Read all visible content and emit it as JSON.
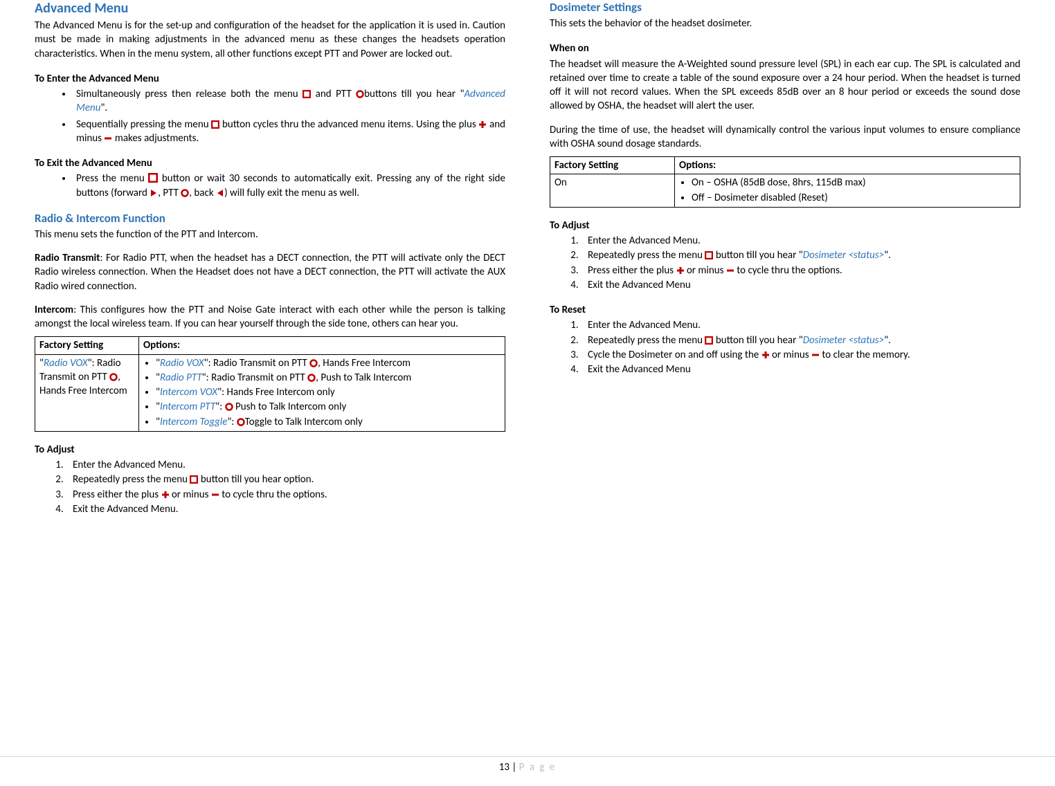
{
  "left": {
    "h_adv": "Advanced Menu",
    "p_adv": "The Advanced Menu is for the set-up and configuration of the headset for the application it is used in. Caution must be made in making adjustments in the advanced menu as these changes the headsets operation characteristics. When in the menu system, all other functions except PTT and Power are locked out.",
    "h_enter": "To Enter the Advanced Menu",
    "enter_b1a": "Simultaneously press then release both the menu ",
    "enter_b1b": " and PTT ",
    "enter_b1c": "buttons till you hear \"",
    "enter_b1_link": "Advanced Menu",
    "enter_b1d": "\".",
    "enter_b2a": "Sequentially pressing the menu ",
    "enter_b2b": " button cycles thru the advanced menu items. Using the plus ",
    "enter_b2c": " and minus ",
    "enter_b2d": " makes adjustments.",
    "h_exit": "To Exit the Advanced Menu",
    "exit_b1a": "Press the menu ",
    "exit_b1b": " button or wait 30 seconds to automatically exit. Pressing any of the right side buttons (forward ",
    "exit_b1c": ", PTT ",
    "exit_b1d": ", back ",
    "exit_b1e": ") will fully exit the menu as well.",
    "h_radio": "Radio & Intercom Function",
    "p_radio_intro": "This menu sets the function of the PTT and Intercom.",
    "p_radio_tx_label": "Radio Transmit",
    "p_radio_tx": ": For Radio PTT, when the headset has a DECT connection, the PTT will activate only the DECT Radio wireless connection. When the Headset does not have a DECT connection, the PTT will activate the AUX Radio wired connection.",
    "p_intercom_label": "Intercom",
    "p_intercom": ": This configures how the PTT and Noise Gate interact with each other while the person is talking amongst the local wireless team. If you can hear yourself through the side tone, others can hear you.",
    "tbl1_h1": "Factory Setting",
    "tbl1_h2": "Options:",
    "tbl1_fs1": "\"",
    "tbl1_fs_link": "Radio VOX",
    "tbl1_fs2": "\": Radio Transmit on PTT ",
    "tbl1_fs3": ", Hands Free Intercom",
    "tbl1_o1a": "\"",
    "tbl1_o1_link": "Radio VOX",
    "tbl1_o1b": "\": Radio Transmit on PTT ",
    "tbl1_o1c": ", Hands Free Intercom",
    "tbl1_o2a": "\"",
    "tbl1_o2_link": "Radio PTT",
    "tbl1_o2b": "\": Radio Transmit on PTT ",
    "tbl1_o2c": ", Push to Talk Intercom",
    "tbl1_o3a": "\"",
    "tbl1_o3_link": "Intercom VOX",
    "tbl1_o3b": "\": Hands Free Intercom only",
    "tbl1_o4a": "\"",
    "tbl1_o4_link": "Intercom PTT",
    "tbl1_o4b": "\": ",
    "tbl1_o4c": " Push to Talk Intercom only",
    "tbl1_o5a": "\"",
    "tbl1_o5_link": "Intercom Toggle",
    "tbl1_o5b": "\": ",
    "tbl1_o5c": "Toggle to Talk Intercom only",
    "h_adjust1": "To Adjust",
    "adj1_1": "Enter the Advanced Menu.",
    "adj1_2a": "Repeatedly press the menu ",
    "adj1_2b": " button till you hear option.",
    "adj1_3a": "Press either the plus ",
    "adj1_3b": " or minus ",
    "adj1_3c": " to cycle thru the options.",
    "adj1_4": "Exit the Advanced Menu."
  },
  "right": {
    "h_dos": "Dosimeter Settings",
    "p_dos_intro": "This sets the behavior of the headset dosimeter.",
    "h_when": "When on",
    "p_when": "The headset will measure the A-Weighted sound pressure level (SPL) in each ear cup. The SPL is calculated and retained over time to create a table of the sound exposure over a 24 hour period. When the headset is turned off it will not record values. When the SPL exceeds 85dB over an 8 hour period or exceeds the sound dose allowed by OSHA, the headset will alert the user.",
    "p_when2": "During the time of use, the headset will dynamically control the various input volumes to ensure compliance with OSHA sound dosage standards.",
    "tbl2_h1": "Factory Setting",
    "tbl2_h2": "Options:",
    "tbl2_fs": "On",
    "tbl2_o1": "On – OSHA (85dB dose, 8hrs, 115dB max)",
    "tbl2_o2": "Off – Dosimeter disabled (Reset)",
    "h_adjust2": "To Adjust",
    "adj2_1": "Enter the Advanced Menu.",
    "adj2_2a": "Repeatedly press the menu ",
    "adj2_2b": " button till you hear \"",
    "adj2_2_link": "Dosimeter <status>",
    "adj2_2c": "\".",
    "adj2_3a": "Press either the plus ",
    "adj2_3b": " or minus ",
    "adj2_3c": " to cycle thru the options.",
    "adj2_4": "Exit the Advanced Menu",
    "h_reset": "To Reset",
    "rst_1": "Enter the Advanced Menu.",
    "rst_2a": "Repeatedly press the menu ",
    "rst_2b": " button till you hear \"",
    "rst_2_link": "Dosimeter <status>",
    "rst_2c": "\".",
    "rst_3a": "Cycle the Dosimeter on and off using the ",
    "rst_3b": " or minus ",
    "rst_3c": " to clear the memory.",
    "rst_4": "Exit the Advanced Menu"
  },
  "footer_num": "13",
  "footer_sep": " | ",
  "footer_page": "P a g e"
}
